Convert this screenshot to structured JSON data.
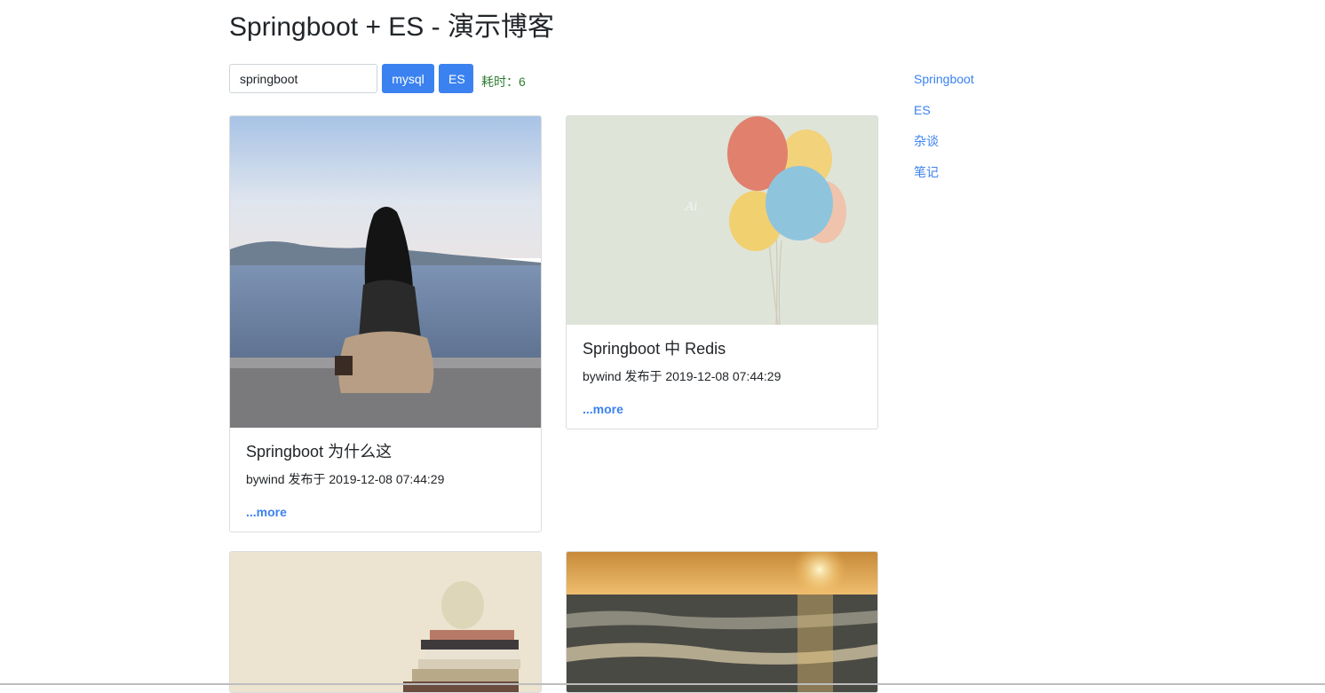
{
  "header": {
    "title": "Springboot + ES - 演示博客"
  },
  "search": {
    "value": "springboot",
    "mysql_label": "mysql",
    "es_label": "ES",
    "elapsed_label": "耗时：6"
  },
  "sidebar": {
    "items": [
      {
        "label": "Springboot"
      },
      {
        "label": "ES"
      },
      {
        "label": "杂谈"
      },
      {
        "label": "笔记"
      }
    ]
  },
  "posts": [
    {
      "title": "Springboot 为什么这",
      "meta": "bywind 发布于 2019-12-08 07:44:29",
      "more": "...more",
      "image": "girl-by-lake"
    },
    {
      "title": "Springboot 中 Redis",
      "meta": "bywind 发布于 2019-12-08 07:44:29",
      "more": "...more",
      "image": "balloons"
    },
    {
      "title": "",
      "meta": "",
      "more": "",
      "image": "books-apple"
    },
    {
      "title": "",
      "meta": "",
      "more": "",
      "image": "sunset-beach"
    }
  ],
  "colors": {
    "accent": "#3b82f0",
    "elapsed": "#2e7d32",
    "border": "#dcdcdc"
  }
}
